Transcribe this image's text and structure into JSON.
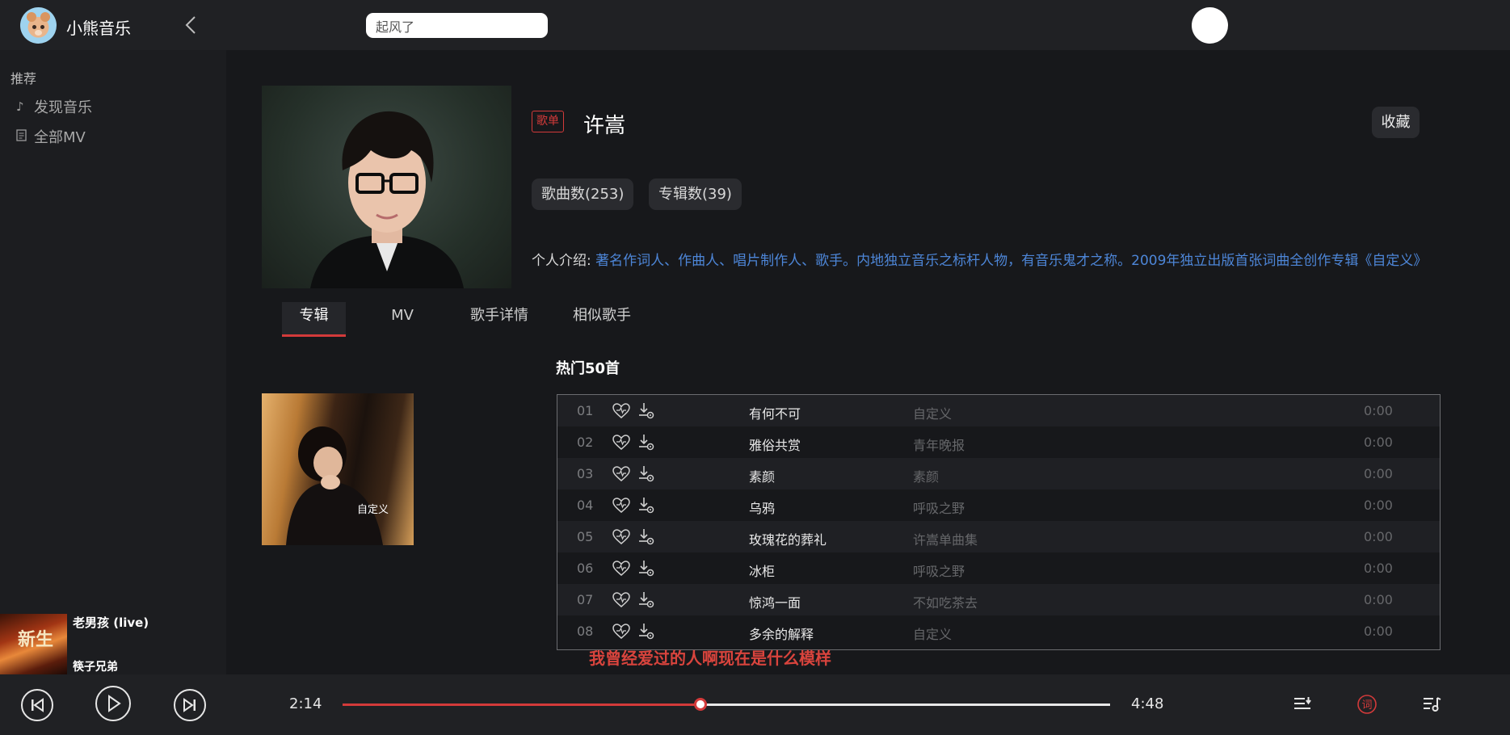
{
  "header": {
    "app_title": "小熊音乐",
    "search_value": "起风了"
  },
  "sidebar": {
    "section_label": "推荐",
    "items": [
      {
        "label": "发现音乐",
        "icon": "music-note-icon"
      },
      {
        "label": "全部MV",
        "icon": "document-icon"
      }
    ]
  },
  "mini_player": {
    "song_title": "老男孩 (live)",
    "artist": "筷子兄弟",
    "cover_text": "新生"
  },
  "artist": {
    "type_badge": "歌单",
    "name": "许嵩",
    "favorite_label": "收藏",
    "song_count_label": "歌曲数(253)",
    "album_count_label": "专辑数(39)",
    "intro_label": "个人介绍:",
    "intro_text": "著名作词人、作曲人、唱片制作人、歌手。内地独立音乐之标杆人物，有音乐鬼才之称。2009年独立出版首张词曲全创作专辑《自定义》"
  },
  "tabs": [
    {
      "label": "专辑",
      "active": true
    },
    {
      "label": "MV",
      "active": false
    },
    {
      "label": "歌手详情",
      "active": false
    },
    {
      "label": "相似歌手",
      "active": false
    }
  ],
  "album_section": {
    "cover_text": "自定义"
  },
  "hot_songs": {
    "title": "热门50首",
    "rows": [
      {
        "num": "01",
        "title": "有何不可",
        "album": "自定义",
        "duration": "0:00"
      },
      {
        "num": "02",
        "title": "雅俗共赏",
        "album": "青年晚报",
        "duration": "0:00"
      },
      {
        "num": "03",
        "title": "素颜",
        "album": "素颜",
        "duration": "0:00"
      },
      {
        "num": "04",
        "title": "乌鸦",
        "album": "呼吸之野",
        "duration": "0:00"
      },
      {
        "num": "05",
        "title": "玫瑰花的葬礼",
        "album": "许嵩单曲集",
        "duration": "0:00"
      },
      {
        "num": "06",
        "title": "冰柜",
        "album": "呼吸之野",
        "duration": "0:00"
      },
      {
        "num": "07",
        "title": "惊鸿一面",
        "album": "不如吃茶去",
        "duration": "0:00"
      },
      {
        "num": "08",
        "title": "多余的解释",
        "album": "自定义",
        "duration": "0:00"
      }
    ]
  },
  "lyric_line": "我曾经爱过的人啊现在是什么模样",
  "player": {
    "current_time": "2:14",
    "total_time": "4:48",
    "progress": 0.4667,
    "lyrics_button": "词"
  },
  "colors": {
    "accent": "#d33a3a",
    "link": "#4d86d8",
    "background": "#1c1d20"
  }
}
